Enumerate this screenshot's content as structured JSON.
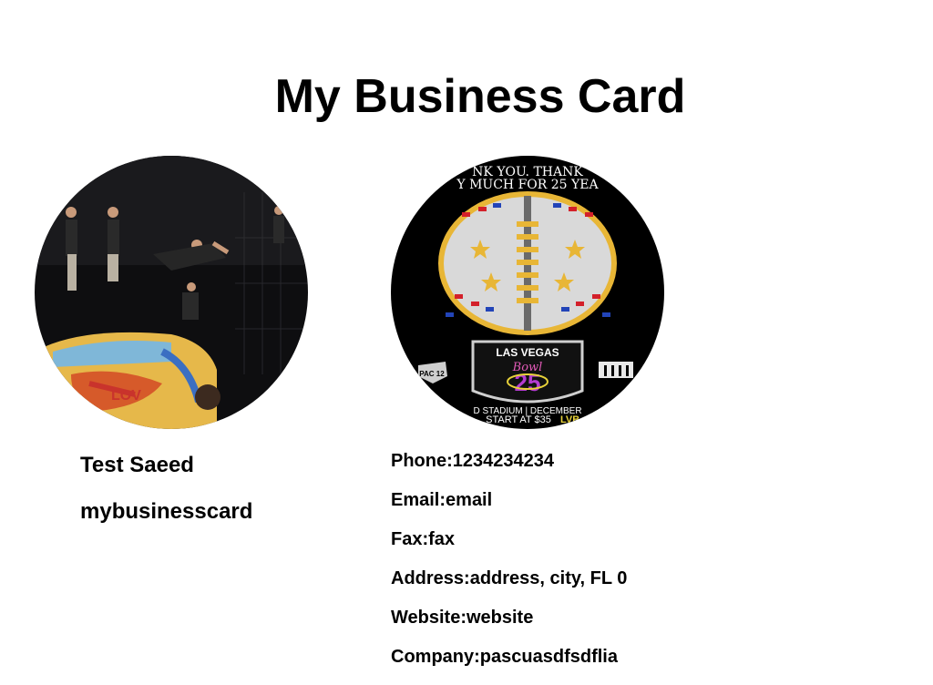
{
  "page": {
    "title": "My Business Card"
  },
  "images": {
    "left_photo": "acrobats-on-painted-van-photo",
    "right_photo": "las-vegas-bowl-football-poster",
    "poster_text": {
      "line1": "NK YOU. THANK",
      "line2": "Y MUCH FOR 25 YEA",
      "badge_title": "LAS VEGAS",
      "badge_script": "Bowl",
      "badge_number": "25",
      "left_logo": "PAC 12",
      "footer1": "D STADIUM | DECEMBER",
      "footer2": "START AT $35",
      "footer2_accent": "LVB"
    }
  },
  "card": {
    "name": "Test Saeed",
    "tagline": "mybusinesscard",
    "phone_label": "Phone:",
    "phone_value": "1234234234",
    "email_label": "Email:",
    "email_value": "email",
    "fax_label": "Fax:",
    "fax_value": "fax",
    "address_label": "Address:",
    "address_value": "address, city, FL 0",
    "website_label": "Website:",
    "website_value": "website",
    "company_label": "Company:",
    "company_value": "pascuasdfsdflia"
  },
  "colors": {
    "poster_gold": "#e8b636",
    "poster_red": "#d3202a",
    "poster_blue": "#2244b8"
  }
}
